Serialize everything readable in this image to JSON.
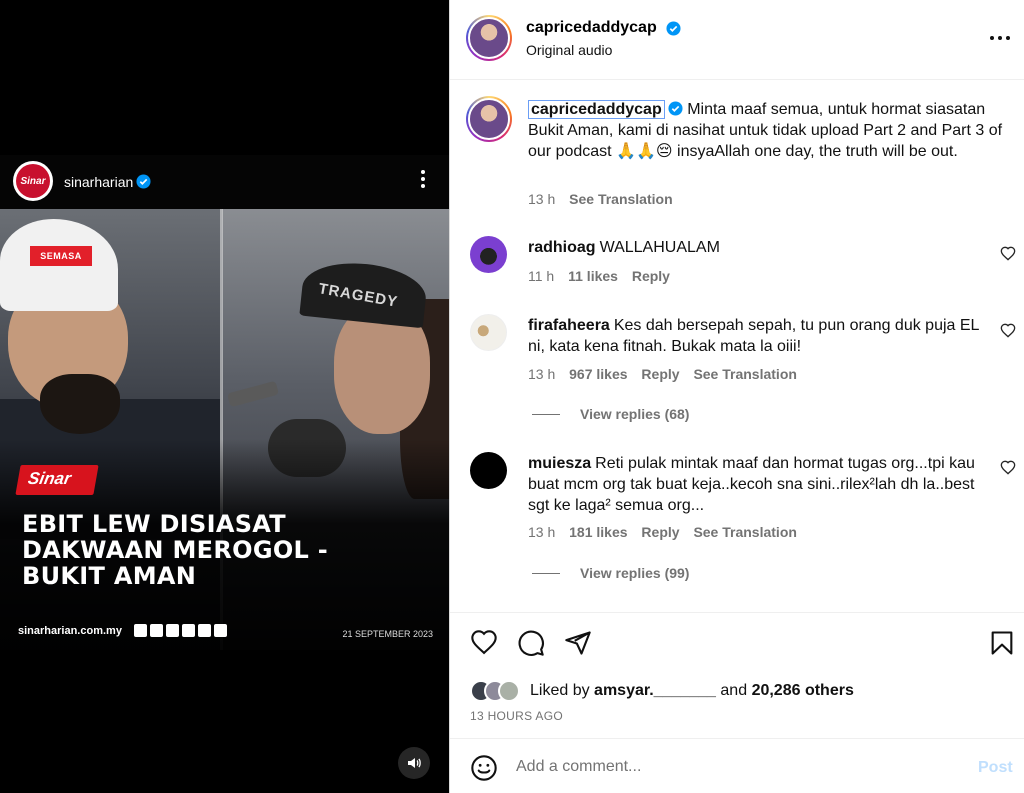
{
  "video": {
    "source_name": "sinarharian",
    "logo_text": "Sinar",
    "badge": "SEMASA",
    "hat_text": "TRAGEDY",
    "headline_lines": [
      "EBIT LEW DISIASAT",
      "DAKWAAN MEROGOL -",
      "BUKIT AMAN"
    ],
    "site": "sinarharian.com.my",
    "date": "21 SEPTEMBER 2023"
  },
  "header": {
    "username": "capricedaddycap",
    "audio": "Original audio"
  },
  "caption": {
    "username": "capricedaddycap",
    "text": "Minta maaf semua, untuk hormat siasatan Bukit Aman, kami di nasihat untuk tidak upload Part 2 and Part 3 of our podcast 🙏🙏😔 insyaAllah one day, the truth will be out.",
    "time": "13 h",
    "see_translation": "See Translation"
  },
  "comments": [
    {
      "username": "radhioag",
      "text": "WALLAHUALAM",
      "time": "11 h",
      "likes": "11 likes",
      "reply": "Reply"
    },
    {
      "username": "firafaheera",
      "text": "Kes dah bersepah sepah, tu pun orang duk puja EL ni, kata kena fitnah. Bukak mata la oiii!",
      "time": "13 h",
      "likes": "967 likes",
      "reply": "Reply",
      "see_translation": "See Translation",
      "view_replies": "View replies (68)"
    },
    {
      "username": "muiesza",
      "text": "Reti pulak mintak maaf dan hormat tugas org...tpi kau buat mcm org tak buat keja..kecoh sna sini..rilex²lah dh la..best sgt ke laga² semua org...",
      "time": "13 h",
      "likes": "181 likes",
      "reply": "Reply",
      "see_translation": "See Translation",
      "view_replies": "View replies (99)"
    }
  ],
  "likes": {
    "prefix": "Liked by",
    "user": "amsyar._______",
    "middle": "and",
    "others": "20,286 others",
    "time_ago": "13 HOURS AGO"
  },
  "comment_box": {
    "placeholder": "Add a comment...",
    "post": "Post"
  },
  "colors": {
    "verified": "#0095f6",
    "post_disabled": "#c0dffd",
    "secondary_text": "#737373"
  }
}
